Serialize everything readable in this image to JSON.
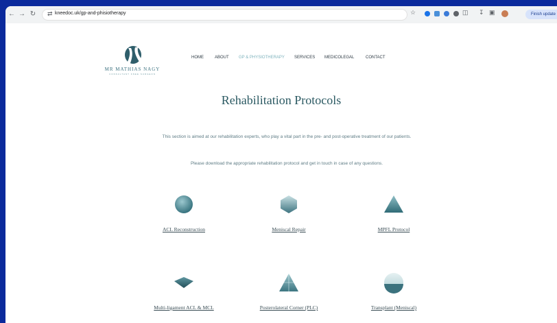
{
  "browser": {
    "url": "kneedoc.uk/gp-and-phisiotherapy",
    "update_button": "Finish update"
  },
  "logo": {
    "name": "MR MATHIAS NAGY",
    "tagline": "CONSULTANT KNEE SURGEON"
  },
  "nav": {
    "items": [
      "HOME",
      "ABOUT",
      "GP & PHYSIOTHERAPY",
      "SERVICES",
      "MEDICOLEGAL",
      "CONTACT"
    ],
    "active": "GP & PHYSIOTHERAPY"
  },
  "main": {
    "title": "Rehabilitation Protocols",
    "intro": "This section is aimed at our rehabilitation experts, who play a vital part in the pre- and post-operative treatment of our patients.",
    "instruction": "Please download the appropriate rehabilitation protocol and get in touch in case of any questions."
  },
  "protocols": [
    {
      "label": "ACL Reconstruction",
      "icon": "sphere-icon"
    },
    {
      "label": "Meniscal Repair",
      "icon": "hexagon-icon"
    },
    {
      "label": "MPFL Protocol",
      "icon": "pyramid-icon"
    },
    {
      "label": "Multi-ligament ACL & MCL",
      "icon": "octahedron-icon"
    },
    {
      "label": "Posterolateral Corner (PLC)",
      "icon": "tetrahedron-icon"
    },
    {
      "label": "Transplant (Meniscal)",
      "icon": "split-sphere-icon"
    }
  ],
  "colors": {
    "accent": "#3d7280",
    "nav_active": "#7eb3bd",
    "frame": "#0b2a9c"
  }
}
